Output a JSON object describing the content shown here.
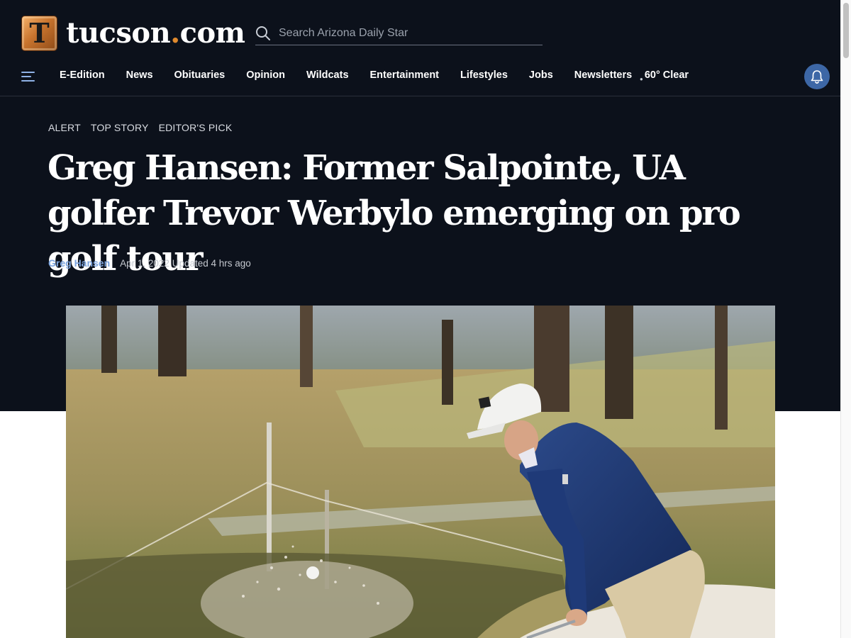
{
  "brand": {
    "logo_letter": "T",
    "site_name_main": "tucson",
    "site_name_dot": ".",
    "site_name_tld": "com"
  },
  "search": {
    "placeholder": "Search Arizona Daily Star",
    "value": ""
  },
  "nav": {
    "items": [
      {
        "label": "E-Edition"
      },
      {
        "label": "News"
      },
      {
        "label": "Obituaries"
      },
      {
        "label": "Opinion"
      },
      {
        "label": "Wildcats"
      },
      {
        "label": "Entertainment"
      },
      {
        "label": "Lifestyles"
      },
      {
        "label": "Jobs"
      },
      {
        "label": "Newsletters"
      }
    ],
    "weather": "60° Clear"
  },
  "article": {
    "tags": [
      "ALERT",
      "TOP STORY",
      "EDITOR'S PICK"
    ],
    "headline": "Greg Hansen: Former Salpointe, UA golfer Trevor Werbylo emerging on pro golf tour",
    "author": "Greg Hansen",
    "date": "Apr 1, 2022 Updated 4 hrs ago"
  },
  "icons": {
    "menu": "hamburger-menu-icon",
    "search": "search-icon",
    "weather": "weather-icon",
    "notifications": "bell-icon"
  },
  "colors": {
    "header_bg": "#0c111b",
    "author_link": "#7ea6e0",
    "bell_bg": "#3d67a6",
    "logo_accent": "#e08a2e"
  }
}
